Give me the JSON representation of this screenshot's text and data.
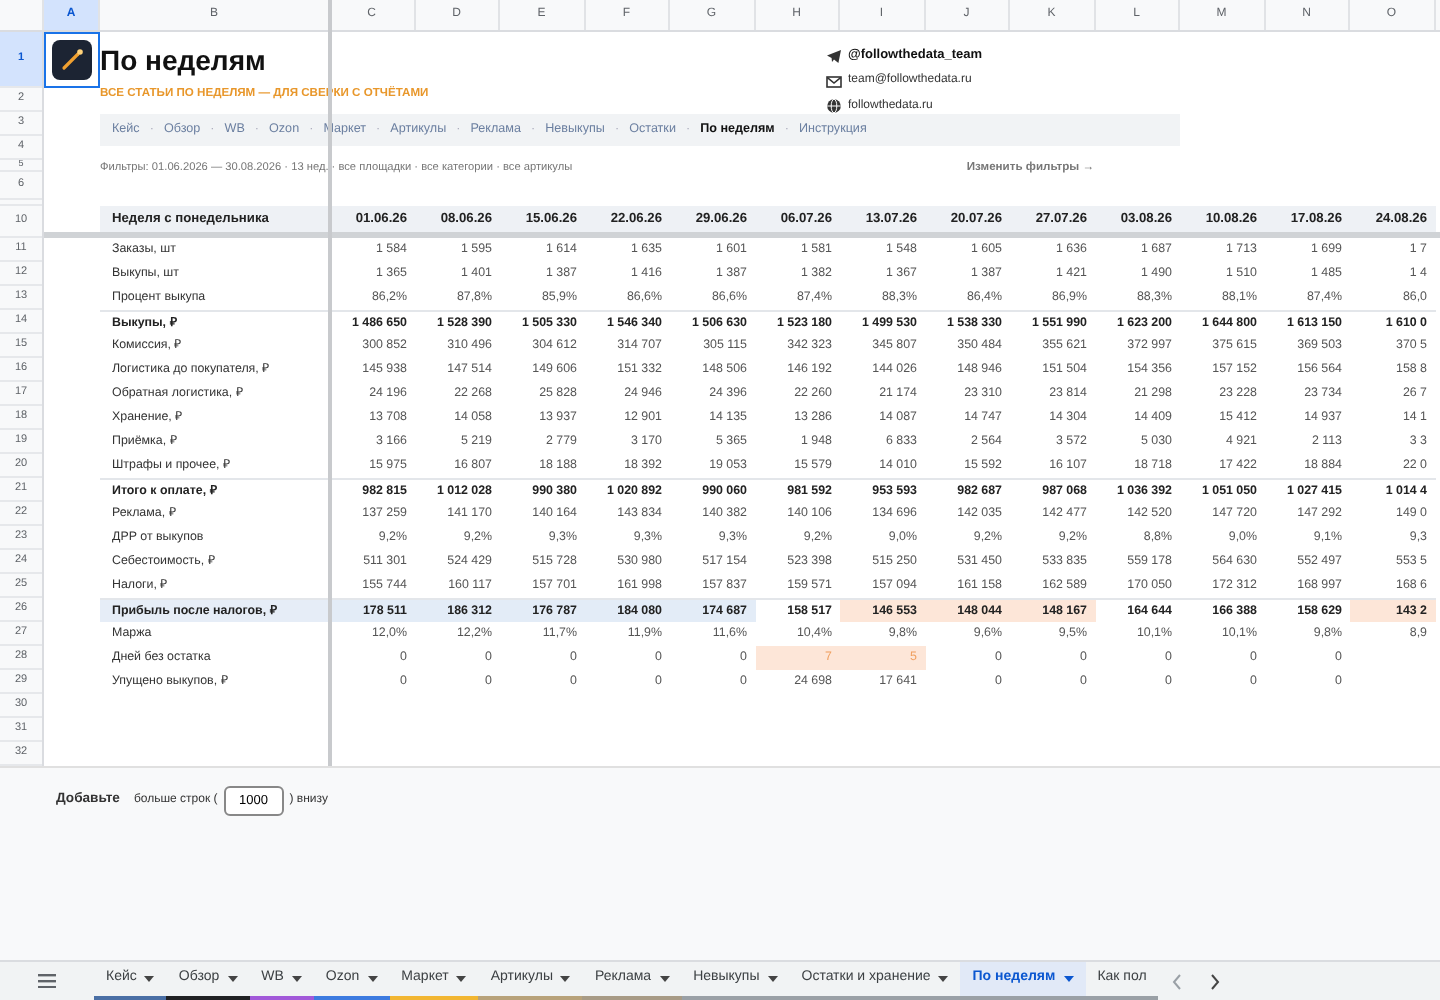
{
  "sheet": {
    "columns": [
      {
        "label": "A",
        "selected": true
      },
      {
        "label": "B",
        "selected": false
      },
      {
        "label": "C",
        "selected": false
      },
      {
        "label": "D",
        "selected": false
      },
      {
        "label": "E",
        "selected": false
      },
      {
        "label": "F",
        "selected": false
      },
      {
        "label": "G",
        "selected": false
      },
      {
        "label": "H",
        "selected": false
      },
      {
        "label": "I",
        "selected": false
      },
      {
        "label": "J",
        "selected": false
      },
      {
        "label": "K",
        "selected": false
      },
      {
        "label": "L",
        "selected": false
      },
      {
        "label": "M",
        "selected": false
      },
      {
        "label": "N",
        "selected": false
      },
      {
        "label": "O",
        "selected": false
      }
    ],
    "row_numbers": [
      {
        "label": "1",
        "selected": true
      },
      {
        "label": "2",
        "selected": false
      },
      {
        "label": "3",
        "selected": false
      },
      {
        "label": "4",
        "selected": false
      },
      {
        "label": "5",
        "selected": false
      },
      {
        "label": "6",
        "selected": false
      },
      {
        "label": "10",
        "selected": false
      },
      {
        "label": "11",
        "selected": false
      },
      {
        "label": "12",
        "selected": false
      },
      {
        "label": "13",
        "selected": false
      },
      {
        "label": "14",
        "selected": false
      },
      {
        "label": "15",
        "selected": false
      },
      {
        "label": "16",
        "selected": false
      },
      {
        "label": "17",
        "selected": false
      },
      {
        "label": "18",
        "selected": false
      },
      {
        "label": "19",
        "selected": false
      },
      {
        "label": "20",
        "selected": false
      },
      {
        "label": "21",
        "selected": false
      },
      {
        "label": "22",
        "selected": false
      },
      {
        "label": "23",
        "selected": false
      },
      {
        "label": "24",
        "selected": false
      },
      {
        "label": "25",
        "selected": false
      },
      {
        "label": "26",
        "selected": false
      },
      {
        "label": "27",
        "selected": false
      },
      {
        "label": "28",
        "selected": false
      },
      {
        "label": "29",
        "selected": false
      },
      {
        "label": "30",
        "selected": false
      },
      {
        "label": "31",
        "selected": false
      },
      {
        "label": "32",
        "selected": false
      }
    ]
  },
  "header": {
    "title": "По неделям",
    "subtitle": "ВСЕ СТАТЬИ ПО НЕДЕЛЯМ — ДЛЯ СВЕРКИ С ОТЧЁТАМИ",
    "contacts": [
      {
        "kind": "telegram",
        "text": "@followthedata_team"
      },
      {
        "kind": "email",
        "text": "team@followthedata.ru"
      },
      {
        "kind": "web",
        "text": "followthedata.ru"
      }
    ],
    "nav_separator": "·",
    "nav": [
      {
        "label": "Кейс",
        "selected": false
      },
      {
        "label": "Обзор",
        "selected": false
      },
      {
        "label": "WB",
        "selected": false
      },
      {
        "label": "Ozon",
        "selected": false
      },
      {
        "label": "Маркет",
        "selected": false
      },
      {
        "label": "Артикулы",
        "selected": false
      },
      {
        "label": "Реклама",
        "selected": false
      },
      {
        "label": "Невыкупы",
        "selected": false
      },
      {
        "label": "Остатки",
        "selected": false
      },
      {
        "label": "По неделям",
        "selected": true
      },
      {
        "label": "Инструкция",
        "selected": false
      }
    ],
    "filters": "Фильтры: 01.06.2026 — 30.08.2026 · 13 нед. · все площадки · все категории · все артикулы",
    "change_filters": "Изменить фильтры →"
  },
  "table": {
    "header_label": "Неделя с понедельника",
    "columns": [
      "01.06.26",
      "08.06.26",
      "15.06.26",
      "22.06.26",
      "29.06.26",
      "06.07.26",
      "13.07.26",
      "20.07.26",
      "27.07.26",
      "03.08.26",
      "10.08.26",
      "17.08.26",
      "24.08.26"
    ],
    "rows": [
      {
        "label": "Заказы, шт",
        "kind": "plain",
        "values": [
          "1 584",
          "1 595",
          "1 614",
          "1 635",
          "1 601",
          "1 581",
          "1 548",
          "1 605",
          "1 636",
          "1 687",
          "1 713",
          "1 699",
          "1 7"
        ]
      },
      {
        "label": "Выкупы, шт",
        "kind": "plain",
        "values": [
          "1 365",
          "1 401",
          "1 387",
          "1 416",
          "1 387",
          "1 382",
          "1 367",
          "1 387",
          "1 421",
          "1 490",
          "1 510",
          "1 485",
          "1 4"
        ]
      },
      {
        "label": "Процент выкупа",
        "kind": "plain",
        "values": [
          "86,2%",
          "87,8%",
          "85,9%",
          "86,6%",
          "86,6%",
          "87,4%",
          "88,3%",
          "86,4%",
          "86,9%",
          "88,3%",
          "88,1%",
          "87,4%",
          "86,0"
        ]
      },
      {
        "label": "Выкупы, ₽",
        "kind": "subtotal",
        "values": [
          "1 486 650",
          "1 528 390",
          "1 505 330",
          "1 546 340",
          "1 506 630",
          "1 523 180",
          "1 499 530",
          "1 538 330",
          "1 551 990",
          "1 623 200",
          "1 644 800",
          "1 613 150",
          "1 610 0"
        ]
      },
      {
        "label": "Комиссия, ₽",
        "kind": "plain",
        "values": [
          "300 852",
          "310 496",
          "304 612",
          "314 707",
          "305 115",
          "342 323",
          "345 807",
          "350 484",
          "355 621",
          "372 997",
          "375 615",
          "369 503",
          "370 5"
        ]
      },
      {
        "label": "Логистика до покупателя, ₽",
        "kind": "plain",
        "values": [
          "145 938",
          "147 514",
          "149 606",
          "151 332",
          "148 506",
          "146 192",
          "144 026",
          "148 946",
          "151 504",
          "154 356",
          "157 152",
          "156 564",
          "158 8"
        ]
      },
      {
        "label": "Обратная логистика, ₽",
        "kind": "plain",
        "values": [
          "24 196",
          "22 268",
          "25 828",
          "24 946",
          "24 396",
          "22 260",
          "21 174",
          "23 310",
          "23 814",
          "21 298",
          "23 228",
          "23 734",
          "26 7"
        ]
      },
      {
        "label": "Хранение, ₽",
        "kind": "plain",
        "values": [
          "13 708",
          "14 058",
          "13 937",
          "12 901",
          "14 135",
          "13 286",
          "14 087",
          "14 747",
          "14 304",
          "14 409",
          "15 412",
          "14 937",
          "14 1"
        ]
      },
      {
        "label": "Приёмка, ₽",
        "kind": "plain",
        "values": [
          "3 166",
          "5 219",
          "2 779",
          "3 170",
          "5 365",
          "1 948",
          "6 833",
          "2 564",
          "3 572",
          "5 030",
          "4 921",
          "2 113",
          "3 3"
        ]
      },
      {
        "label": "Штрафы и прочее, ₽",
        "kind": "plain",
        "values": [
          "15 975",
          "16 807",
          "18 188",
          "18 392",
          "19 053",
          "15 579",
          "14 010",
          "15 592",
          "16 107",
          "18 718",
          "17 422",
          "18 884",
          "22 0"
        ]
      },
      {
        "label": "Итого к оплате, ₽",
        "kind": "subtotal",
        "values": [
          "982 815",
          "1 012 028",
          "990 380",
          "1 020 892",
          "990 060",
          "981 592",
          "953 593",
          "982 687",
          "987 068",
          "1 036 392",
          "1 051 050",
          "1 027 415",
          "1 014 4"
        ]
      },
      {
        "label": "Реклама, ₽",
        "kind": "plain",
        "values": [
          "137 259",
          "141 170",
          "140 164",
          "143 834",
          "140 382",
          "140 106",
          "134 696",
          "142 035",
          "142 477",
          "142 520",
          "147 720",
          "147 292",
          "149 0"
        ]
      },
      {
        "label": "ДРР от выкупов",
        "kind": "plain",
        "values": [
          "9,2%",
          "9,2%",
          "9,3%",
          "9,3%",
          "9,3%",
          "9,2%",
          "9,0%",
          "9,2%",
          "9,2%",
          "8,8%",
          "9,0%",
          "9,1%",
          "9,3"
        ]
      },
      {
        "label": "Себестоимость, ₽",
        "kind": "plain",
        "values": [
          "511 301",
          "524 429",
          "515 728",
          "530 980",
          "517 154",
          "523 398",
          "515 250",
          "531 450",
          "533 835",
          "559 178",
          "564 630",
          "552 497",
          "553 5"
        ]
      },
      {
        "label": "Налоги, ₽",
        "kind": "plain",
        "values": [
          "155 744",
          "160 117",
          "157 701",
          "161 998",
          "157 837",
          "159 571",
          "157 094",
          "161 158",
          "162 589",
          "170 050",
          "172 312",
          "168 997",
          "168 6"
        ]
      },
      {
        "label": "Прибыль после налогов, ₽",
        "kind": "profit",
        "cells": [
          {
            "text": "178 511",
            "color": "#e3ecf7"
          },
          {
            "text": "186 312",
            "color": "#e3ecf7"
          },
          {
            "text": "176 787",
            "color": "#e3ecf7"
          },
          {
            "text": "184 080",
            "color": "#e3ecf7"
          },
          {
            "text": "174 687",
            "color": "#e3ecf7"
          },
          {
            "text": "158 517"
          },
          {
            "text": "146 553",
            "color": "#fde6d8"
          },
          {
            "text": "148 044",
            "color": "#fde6d8"
          },
          {
            "text": "148 167",
            "color": "#fde6d8"
          },
          {
            "text": "164 644"
          },
          {
            "text": "166 388"
          },
          {
            "text": "158 629"
          },
          {
            "text": "143 2",
            "color": "#fde6d8"
          }
        ]
      },
      {
        "label": "Маржа",
        "kind": "plain",
        "values": [
          "12,0%",
          "12,2%",
          "11,7%",
          "11,9%",
          "11,6%",
          "10,4%",
          "9,8%",
          "9,6%",
          "9,5%",
          "10,1%",
          "10,1%",
          "9,8%",
          "8,9"
        ]
      },
      {
        "label": "Дней без остатка",
        "kind": "plain",
        "cells": [
          {
            "text": "0",
            "warning": false
          },
          {
            "text": "0",
            "warning": false
          },
          {
            "text": "0",
            "warning": false
          },
          {
            "text": "0",
            "warning": false
          },
          {
            "text": "0",
            "warning": false
          },
          {
            "text": "7",
            "color": "#fde6d8",
            "warning": true
          },
          {
            "text": "5",
            "color": "#fde6d8",
            "warning": true
          },
          {
            "text": "0",
            "warning": false
          },
          {
            "text": "0",
            "warning": false
          },
          {
            "text": "0",
            "warning": false
          },
          {
            "text": "0",
            "warning": false
          },
          {
            "text": "0",
            "warning": false
          }
        ]
      },
      {
        "label": "Упущено выкупов, ₽",
        "kind": "plain",
        "values": [
          "0",
          "0",
          "0",
          "0",
          "0",
          "24 698",
          "17 641",
          "0",
          "0",
          "0",
          "0",
          "0"
        ]
      }
    ]
  },
  "add_rows": {
    "link": "Добавьте",
    "before": "больше строк (",
    "count": "1000",
    "after": ") внизу"
  },
  "sheet_tabs": [
    {
      "label": "Кейс",
      "selected": false,
      "color": "#4a6fa5",
      "caret": true
    },
    {
      "label": "Обзор",
      "selected": false,
      "color": "#202124",
      "caret": true
    },
    {
      "label": "WB",
      "selected": false,
      "color": "#a259d9",
      "caret": true
    },
    {
      "label": "Ozon",
      "selected": false,
      "color": "#3d7be0",
      "caret": true
    },
    {
      "label": "Маркет",
      "selected": false,
      "color": "#f2b632",
      "caret": true
    },
    {
      "label": "Артикулы",
      "selected": false,
      "color": "#b8a27a",
      "caret": true
    },
    {
      "label": "Реклама",
      "selected": false,
      "color": "#a89b86",
      "caret": true
    },
    {
      "label": "Невыкупы",
      "selected": false,
      "color": "#9aa0a6",
      "caret": true
    },
    {
      "label": "Остатки и хранение",
      "selected": false,
      "color": "#9aa0a6",
      "caret": true
    },
    {
      "label": "По неделям",
      "selected": true,
      "color": "#9aa0a6",
      "caret": true
    },
    {
      "label": "Как пол",
      "selected": false,
      "color": "#9aa0a6",
      "caret": false
    }
  ]
}
